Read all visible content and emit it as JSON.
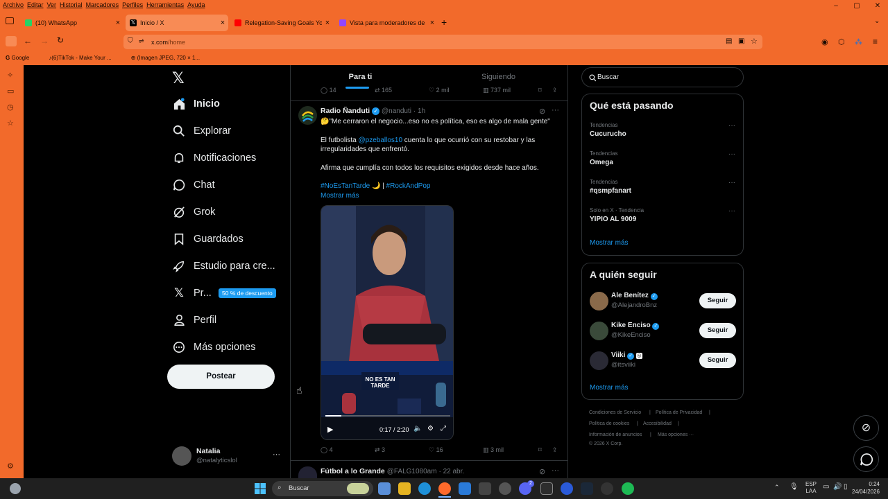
{
  "menubar": [
    "Archivo",
    "Editar",
    "Ver",
    "Historial",
    "Marcadores",
    "Perfiles",
    "Herramientas",
    "Ayuda"
  ],
  "window_controls": [
    "–",
    "▢",
    "✕"
  ],
  "tabs": [
    {
      "title": "(10) WhatsApp",
      "badge": "10",
      "color": "#25d366"
    },
    {
      "title": "Inicio / X",
      "color": "#000000"
    },
    {
      "title": "Relegation-Saving Goals You'll N",
      "color": "#ff0000"
    },
    {
      "title": "Vista para moderadores de nat",
      "color": "#9146ff"
    }
  ],
  "new_tab": "+",
  "url": {
    "domain": "x.com",
    "path": "/home"
  },
  "bookmarks": [
    "Google",
    "(6)TikTok - Make Your ...",
    "(Imagen JPEG, 720 × 1..."
  ],
  "sidebar": {
    "items": [
      {
        "label": "Inicio",
        "icon": "home-icon"
      },
      {
        "label": "Explorar",
        "icon": "search-icon"
      },
      {
        "label": "Notificaciones",
        "icon": "bell-icon"
      },
      {
        "label": "Chat",
        "icon": "chat-icon"
      },
      {
        "label": "Grok",
        "icon": "grok-icon"
      },
      {
        "label": "Guardados",
        "icon": "bookmark-icon"
      },
      {
        "label": "Estudio para cre...",
        "icon": "rocket-icon"
      },
      {
        "label": "Pr...",
        "icon": "x-logo-icon"
      },
      {
        "label": "Perfil",
        "icon": "person-icon"
      },
      {
        "label": "Más opciones",
        "icon": "more-icon"
      }
    ],
    "premium_badge": "50 % de descuento",
    "post_button": "Postear",
    "account": {
      "name": "Natalia",
      "handle": "@natalyticslol",
      "more": "···"
    }
  },
  "timeline": {
    "tabs": [
      "Para ti",
      "Siguiendo"
    ],
    "prev_stats": {
      "replies": "14",
      "reposts": "165",
      "likes": "2 mil",
      "views": "737 mil"
    },
    "tweet": {
      "author": "Radio Ñanduti",
      "handle": "@nanduti",
      "time": "· 1h",
      "line1": "🤔\"Me cerraron el negocio...eso no es política, eso es algo de mala gente\"",
      "line2_pre": "El futbolista ",
      "mention": "@pzeballos10",
      "line2_post": " cuenta lo que ocurrió con su restobar y las",
      "line3": "irregularidades que enfrentó.",
      "line4": "Afirma que cumplía con todos los requisitos exigidos desde hace años.",
      "hashtag1": "#NoEsTanTarde",
      "moon": "🌙",
      "sep": " | ",
      "hashtag2": "#RockAndPop",
      "show_more": "Mostrar más",
      "video_banner": "NO ES TAN TARDE",
      "video_time": "0:17 / 2:20",
      "stats": {
        "replies": "4",
        "reposts": "3",
        "likes": "16",
        "views": "3 mil"
      }
    },
    "next_tweet": {
      "author": "Fútbol a lo Grande",
      "handle": "@FALG1080am",
      "time": "· 22 abr."
    }
  },
  "right": {
    "search_placeholder": "Buscar",
    "trends_title": "Qué está pasando",
    "trends": [
      {
        "meta": "Tendencias",
        "name": "Cucurucho"
      },
      {
        "meta": "Tendencias",
        "name": "Omega"
      },
      {
        "meta": "Tendencias",
        "name": "#qsmpfanart"
      },
      {
        "meta": "Solo en X · Tendencia",
        "name": "YIPIO AL 9009"
      }
    ],
    "trends_more": "Mostrar más",
    "follow_title": "A quién seguir",
    "follow": [
      {
        "name": "Ale Benítez",
        "handle": "@AlejandroBnz",
        "button": "Seguir"
      },
      {
        "name": "Kike Enciso",
        "handle": "@KikeEnciso",
        "button": "Seguir"
      },
      {
        "name": "Viiki",
        "handle": "@itsviiki",
        "button": "Seguir"
      }
    ],
    "follow_more": "Mostrar más",
    "footer": [
      "Condiciones de Servicio",
      "|",
      "Política de Privacidad",
      "|",
      "Política de cookies",
      "|",
      "Accesibilidad",
      "|",
      "Información de anuncios",
      "|",
      "Más opciones ···",
      "© 2026 X Corp."
    ]
  },
  "taskbar": {
    "search": "Buscar",
    "lang": "ESP",
    "lang2": "LAA",
    "time": "0:24",
    "date": "24/04/2026",
    "discord_badge": "2"
  },
  "colors": {
    "accent": "#1d9bf0",
    "chrome": "#f26a2b"
  }
}
